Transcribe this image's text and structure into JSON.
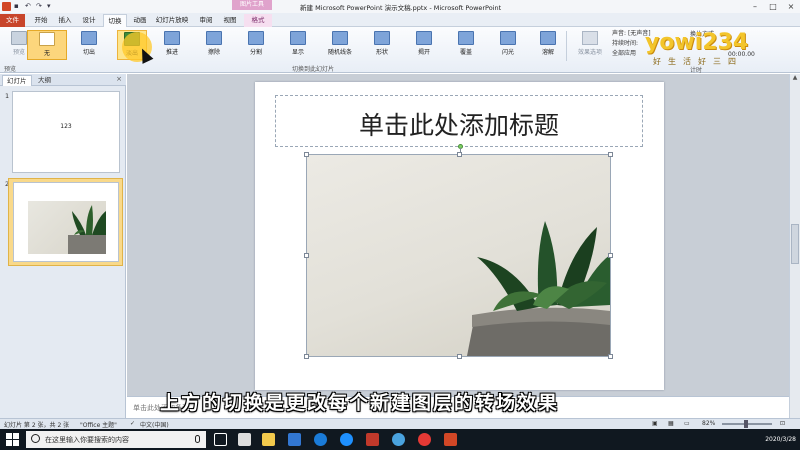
{
  "app": {
    "window_title": "新建 Microsoft PowerPoint 演示文稿.pptx - Microsoft PowerPoint",
    "context_tab_group": "图片工具"
  },
  "tabs": [
    {
      "label": "文件"
    },
    {
      "label": "开始"
    },
    {
      "label": "插入"
    },
    {
      "label": "设计"
    },
    {
      "label": "切换"
    },
    {
      "label": "动画"
    },
    {
      "label": "幻灯片放映"
    },
    {
      "label": "审阅"
    },
    {
      "label": "视图"
    },
    {
      "label": "格式"
    }
  ],
  "active_tab": "切换",
  "ribbon": {
    "preview_label": "预览",
    "preview_group_label": "预览",
    "transitions": [
      {
        "label": "无",
        "icon": "none-transition-icon"
      },
      {
        "label": "切出",
        "icon": "cut-transition-icon"
      },
      {
        "label": "淡出",
        "icon": "fade-transition-icon"
      },
      {
        "label": "推进",
        "icon": "push-transition-icon"
      },
      {
        "label": "擦除",
        "icon": "wipe-transition-icon"
      },
      {
        "label": "分割",
        "icon": "split-transition-icon"
      },
      {
        "label": "显示",
        "icon": "reveal-transition-icon"
      },
      {
        "label": "随机线条",
        "icon": "random-bars-icon"
      },
      {
        "label": "形状",
        "icon": "shape-transition-icon"
      },
      {
        "label": "揭开",
        "icon": "uncover-transition-icon"
      },
      {
        "label": "覆盖",
        "icon": "cover-transition-icon"
      },
      {
        "label": "闪光",
        "icon": "flash-transition-icon"
      },
      {
        "label": "溶解",
        "icon": "dissolve-transition-icon"
      }
    ],
    "effect_options_label": "效果选项",
    "group_label": "切换到此幻灯片",
    "timing": {
      "sound_label": "声音:",
      "sound_value": "[无声音]",
      "duration_label": "持续时间:",
      "apply_all_label": "全部应用",
      "advance_label": "换片方式",
      "after_value": "00:00.00",
      "group_label": "计时"
    }
  },
  "watermark": {
    "main": "yowi234",
    "sub": "好生活好三四"
  },
  "left_panel": {
    "tab_slides": "幻灯片",
    "tab_outline": "大纲",
    "close": "×",
    "slides": [
      {
        "number": "1",
        "text": "123"
      },
      {
        "number": "2",
        "text": ""
      }
    ]
  },
  "slide": {
    "title_placeholder": "单击此处添加标题"
  },
  "notes": {
    "placeholder": "单击此处添加备注"
  },
  "subtitle": "上方的切换是更改每个新建图层的转场效果",
  "status_bar": {
    "slide_info": "幻灯片 第 2 张，共 2 张",
    "theme": "\"Office 主题\"",
    "language": "中文(中国)",
    "zoom": "82%"
  },
  "taskbar": {
    "search_placeholder": "在这里输入你要搜索的内容",
    "date": "2020/3/28"
  },
  "colors": {
    "file_tab": "#c8452b",
    "selected_transition": "#fcd67c",
    "watermark": "#f3c52b"
  }
}
